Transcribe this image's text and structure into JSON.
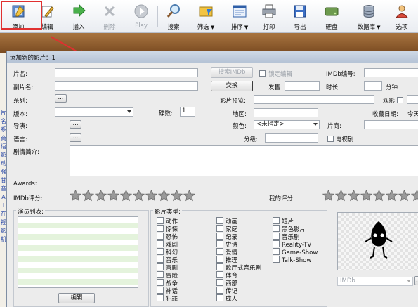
{
  "toolbar": {
    "add": "添加",
    "edit": "编辑",
    "insert": "插入",
    "delete": "删除",
    "play": "Play",
    "search": "搜索",
    "filter": "筛选",
    "sort": "排序",
    "print": "打印",
    "export": "导出",
    "disk": "硬盘",
    "database": "数据库",
    "options": "选项"
  },
  "left_strip": [
    "片",
    "名",
    "系",
    "商",
    "语",
    "影",
    "动",
    "强",
    "甘",
    "音",
    "A",
    "I",
    "在",
    "视",
    "影",
    "机"
  ],
  "dialog": {
    "title": "添加新的影片：1",
    "labels": {
      "title": "片名:",
      "subtitle": "副片名:",
      "series": "系列:",
      "version": "版本:",
      "director": "导演:",
      "language": "语言:",
      "synopsis": "剧情简介:",
      "awards": "Awards:",
      "imdb_rating": "IMDb评分:",
      "my_rating": "我的评分:",
      "cast_list": "演员列表:",
      "genres": "影片类型:",
      "release": "发售",
      "duration": "时长:",
      "minutes": "分钟",
      "imdb_id": "IMDb编号:",
      "preview": "影片预览:",
      "watched": "观影",
      "discs": "碟数:",
      "region": "地区:",
      "collect_date": "收藏日期:",
      "color": "颜色:",
      "producer": "片商:",
      "grade": "分级:",
      "tv_series": "电视剧",
      "lock_edit": "锁定编辑"
    },
    "buttons": {
      "search_imdb": "搜索IMDb",
      "swap": "交换",
      "series_more": "...",
      "director_more": "...",
      "language_more": "...",
      "edit_cast": "编辑",
      "source_more": "..."
    },
    "values": {
      "discs": "1",
      "color": "<未指定>",
      "collect_date": "今天",
      "source": "IMDb",
      "imdb_stars": 10,
      "my_stars": 8
    },
    "genres_col1": [
      "动作",
      "惊悚",
      "恐怖",
      "戏剧",
      "科幻",
      "音乐",
      "喜剧",
      "冒险",
      "战争",
      "神话",
      "犯罪"
    ],
    "genres_col2": [
      "动画",
      "家庭",
      "纪录",
      "史诗",
      "爱情",
      "推理",
      "歌厅式音乐剧",
      "体育",
      "西部",
      "传记",
      "成人"
    ],
    "genres_col3": [
      "短片",
      "黑色影片",
      "音乐剧",
      "Reality-TV",
      "Game-Show",
      "Talk-Show"
    ]
  },
  "colors": {
    "accent_red": "#e03030",
    "title_bar": "#c5d1e1",
    "star": "#9a9a9a"
  }
}
